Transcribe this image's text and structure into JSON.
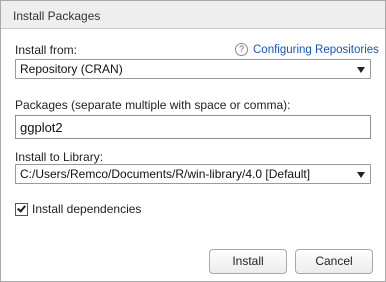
{
  "window": {
    "title": "Install Packages"
  },
  "install_from": {
    "label": "Install from:",
    "selected": "Repository (CRAN)"
  },
  "help": {
    "icon": "?",
    "link_text": "Configuring Repositories"
  },
  "packages": {
    "label": "Packages (separate multiple with space or comma):",
    "value": "ggplot2"
  },
  "install_to": {
    "label": "Install to Library:",
    "selected": "C:/Users/Remco/Documents/R/win-library/4.0 [Default]"
  },
  "dependencies": {
    "label": "Install dependencies",
    "checked": true
  },
  "buttons": {
    "install": "Install",
    "cancel": "Cancel"
  }
}
